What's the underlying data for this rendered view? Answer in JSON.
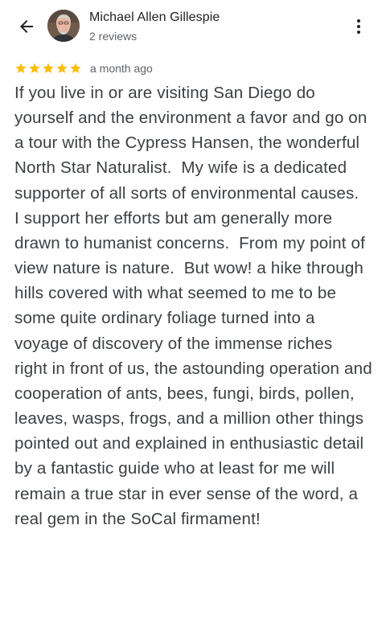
{
  "header": {
    "back_icon": "arrow-back-icon",
    "reviewer_name": "Michael Allen Gillespie",
    "review_count": "2 reviews",
    "more_icon": "more-vert-icon"
  },
  "review": {
    "stars": 5,
    "star_color": "#fbbc04",
    "date": "a month ago",
    "text": "If you live in or are visiting San Diego do yourself and the environment a favor and go on a tour with the Cypress Hansen, the wonderful North Star Naturalist.  My wife is a dedicated supporter of all sorts of environmental causes.  I support her efforts but am generally more drawn to humanist concerns.  From my point of view nature is nature.  But wow! a hike through hills covered with what seemed to me to be some quite ordinary foliage turned into a voyage of discovery of the immense riches  right in front of us, the astounding operation and cooperation of ants, bees, fungi, birds, pollen, leaves, wasps, frogs, and a million other things pointed out and explained in enthusiastic detail by a fantastic guide who at least for me will remain a true star in ever sense of the word, a real gem in the SoCal firmament!"
  }
}
